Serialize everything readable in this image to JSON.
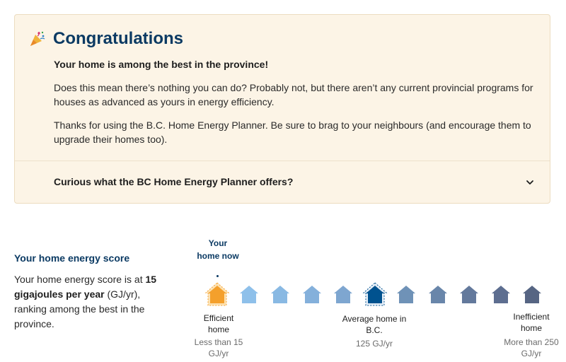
{
  "card": {
    "title": "Congratulations",
    "headline": "Your home is among the best in the province!",
    "paragraph1": "Does this mean there’s nothing you can do? Probably not, but there aren’t any current provincial programs for houses as advanced as yours in energy efficiency.",
    "paragraph2": "Thanks for using the B.C. Home Energy Planner. Be sure to brag to your neighbours (and encourage them to upgrade their homes too).",
    "accordion_label": "Curious what the BC Home Energy Planner offers?",
    "icon": "party-popper-icon",
    "accordion_icon": "chevron-down-icon"
  },
  "score": {
    "title": "Your home energy score",
    "desc_prefix": "Your home energy score is at",
    "desc_value": "15 gigajoules per year",
    "desc_suffix": " (GJ/yr), ranking among the best in the province."
  },
  "scale": {
    "you_label": "Your home now",
    "current_index": 0,
    "average_index": 5,
    "house_colors": [
      "#f4a02c",
      "#8ec0ea",
      "#89b9e3",
      "#84b0db",
      "#7ea6d0",
      "#00528f",
      "#6f92b7",
      "#6986aa",
      "#63799c",
      "#5d6e90",
      "#566583"
    ],
    "efficient_label": "Efficient home",
    "efficient_sub": "Less than 15 GJ/yr",
    "average_label": "Average home in B.C.",
    "average_sub": "125 GJ/yr",
    "inefficient_label": "Inefficient home",
    "inefficient_sub": "More than 250 GJ/yr"
  }
}
